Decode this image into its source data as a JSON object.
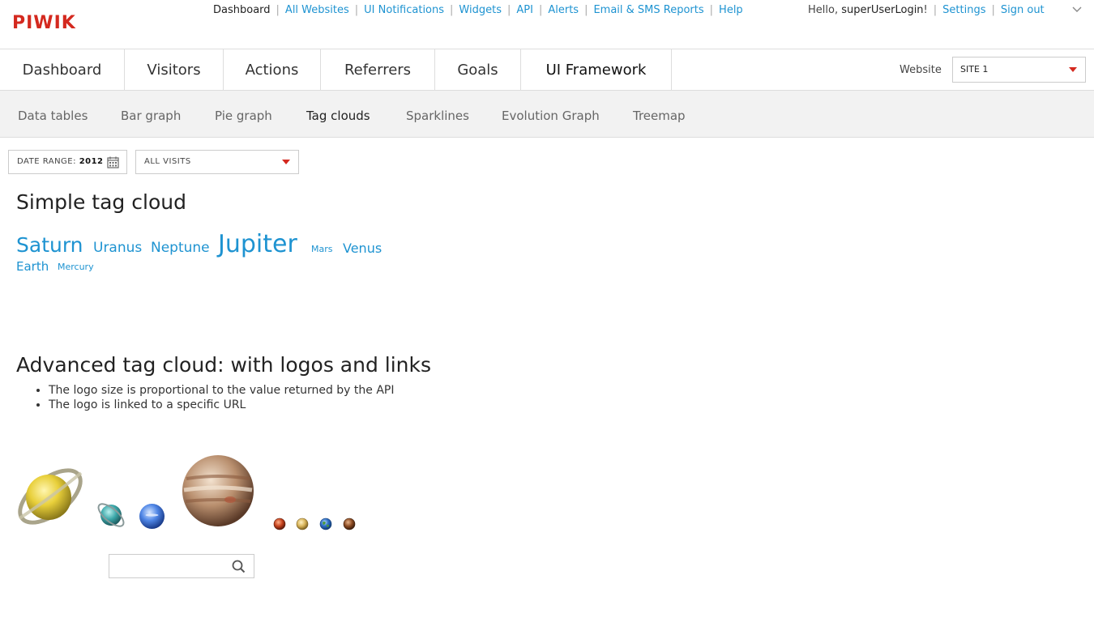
{
  "brand": {
    "logo_text": "PIWIK",
    "color": "#d4291f"
  },
  "accent_color": "#1e93d1",
  "top_nav": {
    "items": [
      {
        "label": "Dashboard",
        "active": true
      },
      {
        "label": "All Websites"
      },
      {
        "label": "UI Notifications"
      },
      {
        "label": "Widgets"
      },
      {
        "label": "API"
      },
      {
        "label": "Alerts"
      },
      {
        "label": "Email & SMS Reports"
      },
      {
        "label": "Help"
      }
    ]
  },
  "user_nav": {
    "greeting": "Hello,",
    "username": "superUserLogin",
    "greeting_suffix": "!",
    "settings": "Settings",
    "signout": "Sign out",
    "more_icon": "chevron-down-icon"
  },
  "main_menu": {
    "tabs": [
      "Dashboard",
      "Visitors",
      "Actions",
      "Referrers",
      "Goals",
      "UI Framework"
    ],
    "active_tab": "UI Framework"
  },
  "site_selector": {
    "label": "Website",
    "value": "SITE 1"
  },
  "sub_menu": {
    "items": [
      "Data tables",
      "Bar graph",
      "Pie graph",
      "Tag clouds",
      "Sparklines",
      "Evolution Graph",
      "Treemap"
    ],
    "active": "Tag clouds"
  },
  "filters": {
    "date_range_label": "DATE RANGE:",
    "date_range_value": "2012",
    "calendar_icon": "calendar-icon",
    "segment": "ALL VISITS"
  },
  "simple_cloud": {
    "title": "Simple tag cloud",
    "tags": [
      "Saturn",
      "Uranus",
      "Neptune",
      "Jupiter",
      "Mars",
      "Venus",
      "Earth",
      "Mercury"
    ]
  },
  "advanced_cloud": {
    "title": "Advanced tag cloud: with logos and links",
    "notes": [
      "The logo size is proportional to the value returned by the API",
      "The logo is linked to a specific URL"
    ],
    "logos": [
      "saturn-logo",
      "uranus-logo",
      "neptune-logo",
      "jupiter-logo",
      "mars-logo",
      "venus-logo",
      "earth-logo",
      "mercury-logo"
    ]
  },
  "search": {
    "value": "",
    "icon": "search-icon"
  }
}
